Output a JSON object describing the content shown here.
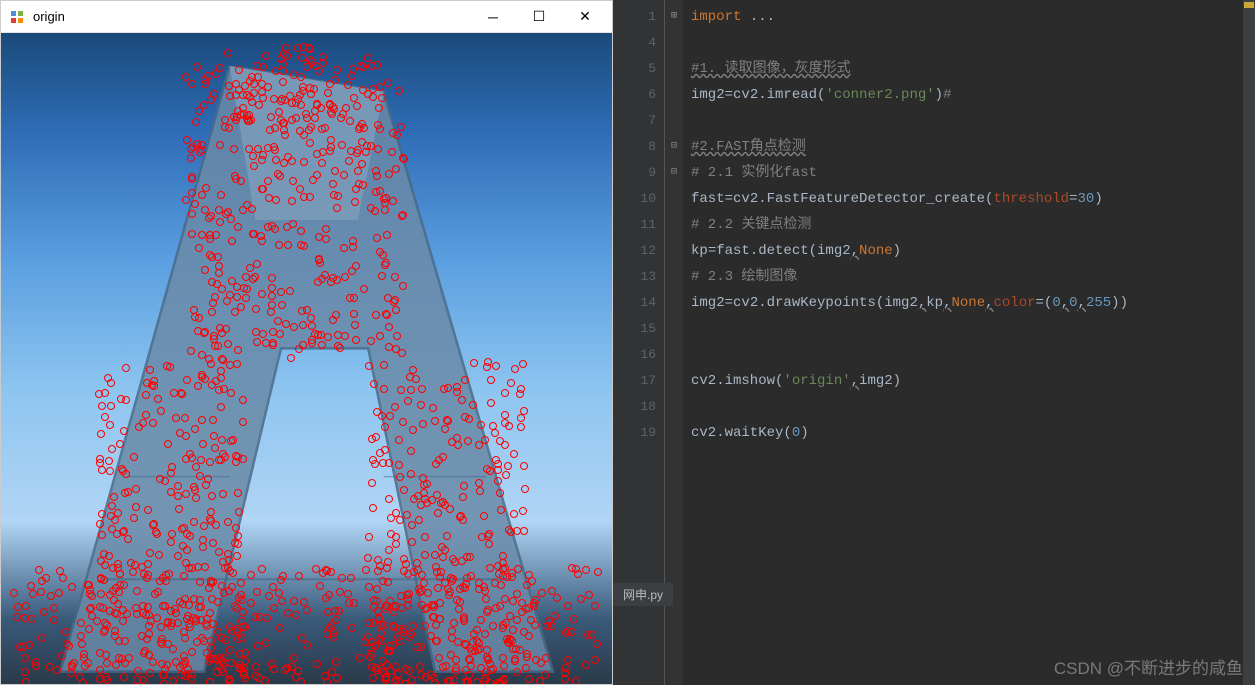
{
  "window": {
    "title": "origin"
  },
  "editor": {
    "filename": "网申.py",
    "lines": [
      {
        "n": 1,
        "fold": "+",
        "tokens": [
          {
            "t": "import ",
            "c": "kw"
          },
          {
            "t": "...",
            "c": "ident"
          }
        ]
      },
      {
        "n": 4,
        "tokens": []
      },
      {
        "n": 5,
        "tokens": [
          {
            "t": "#1. 读取图像，灰度形式",
            "c": "comment-u"
          }
        ]
      },
      {
        "n": 6,
        "tokens": [
          {
            "t": "img2",
            "c": "ident"
          },
          {
            "t": "=",
            "c": "ident"
          },
          {
            "t": "cv2.imread(",
            "c": "func"
          },
          {
            "t": "'conner2.png'",
            "c": "str"
          },
          {
            "t": ")",
            "c": "func"
          },
          {
            "t": "#",
            "c": "comment"
          }
        ]
      },
      {
        "n": 7,
        "tokens": []
      },
      {
        "n": 8,
        "fold": "-",
        "tokens": [
          {
            "t": "#2.FAST角点检测",
            "c": "comment-u"
          }
        ]
      },
      {
        "n": 9,
        "fold": "-",
        "tokens": [
          {
            "t": "# 2.1 实例化fast",
            "c": "comment"
          }
        ]
      },
      {
        "n": 10,
        "tokens": [
          {
            "t": "fast",
            "c": "ident"
          },
          {
            "t": "=",
            "c": "ident"
          },
          {
            "t": "cv2.FastFeatureDetector_create(",
            "c": "func"
          },
          {
            "t": "threshold",
            "c": "param"
          },
          {
            "t": "=",
            "c": "ident"
          },
          {
            "t": "30",
            "c": "num"
          },
          {
            "t": ")",
            "c": "func"
          }
        ]
      },
      {
        "n": 11,
        "tokens": [
          {
            "t": "# 2.2 关键点检测",
            "c": "comment"
          }
        ]
      },
      {
        "n": 12,
        "tokens": [
          {
            "t": "kp",
            "c": "ident"
          },
          {
            "t": "=",
            "c": "ident"
          },
          {
            "t": "fast.detect(img2",
            "c": "func"
          },
          {
            "t": ",",
            "c": "wave"
          },
          {
            "t": "None",
            "c": "none-lit"
          },
          {
            "t": ")",
            "c": "func"
          }
        ]
      },
      {
        "n": 13,
        "tokens": [
          {
            "t": "# 2.3 绘制图像",
            "c": "comment"
          }
        ]
      },
      {
        "n": 14,
        "tokens": [
          {
            "t": "img2",
            "c": "ident"
          },
          {
            "t": "=",
            "c": "ident"
          },
          {
            "t": "cv2.drawKeypoints(img2",
            "c": "func"
          },
          {
            "t": ",",
            "c": "wave"
          },
          {
            "t": "kp",
            "c": "ident"
          },
          {
            "t": ",",
            "c": "wave"
          },
          {
            "t": "None",
            "c": "none-lit"
          },
          {
            "t": ",",
            "c": "wave"
          },
          {
            "t": "color",
            "c": "param"
          },
          {
            "t": "=(",
            "c": "func"
          },
          {
            "t": "0",
            "c": "num"
          },
          {
            "t": ",",
            "c": "wave"
          },
          {
            "t": "0",
            "c": "num"
          },
          {
            "t": ",",
            "c": "wave"
          },
          {
            "t": "255",
            "c": "num"
          },
          {
            "t": "))",
            "c": "func"
          }
        ]
      },
      {
        "n": 15,
        "tokens": []
      },
      {
        "n": 16,
        "tokens": []
      },
      {
        "n": 17,
        "tokens": [
          {
            "t": "cv2.imshow(",
            "c": "func"
          },
          {
            "t": "'origin'",
            "c": "str"
          },
          {
            "t": ",",
            "c": "wave"
          },
          {
            "t": "img2)",
            "c": "func"
          }
        ]
      },
      {
        "n": 18,
        "tokens": []
      },
      {
        "n": 19,
        "tokens": [
          {
            "t": "cv2.waitKey(",
            "c": "func"
          },
          {
            "t": "0",
            "c": "num"
          },
          {
            "t": ")",
            "c": "func"
          }
        ]
      }
    ]
  },
  "watermark": "CSDN @不断进步的咸鱼"
}
